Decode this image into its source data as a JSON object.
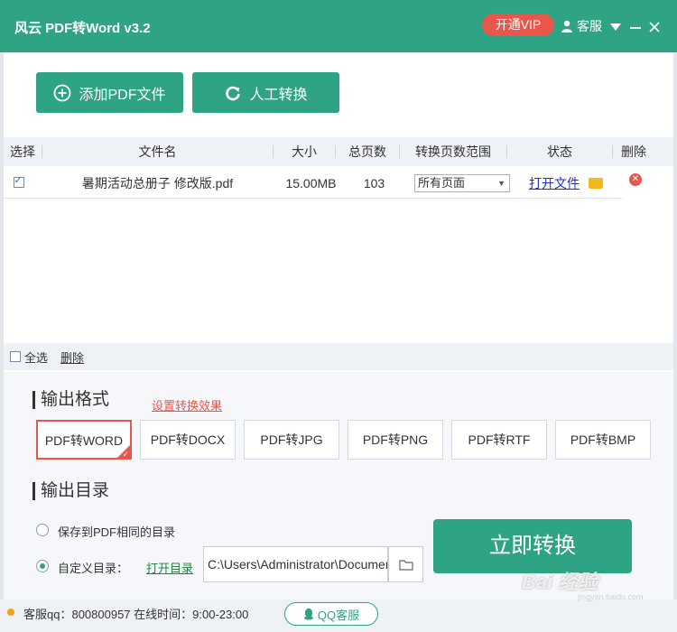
{
  "titlebar": {
    "title": "风云 PDF转Word v3.2",
    "vip_label": "开通VIP",
    "service_label": "客服",
    "menu_icon": "caret-down-icon",
    "minimize_icon": "minimize-icon",
    "close_icon": "close-icon"
  },
  "toolbar": {
    "add_pdf_label": "添加PDF文件",
    "manual_label": "人工转换"
  },
  "table": {
    "headers": [
      "选择",
      "文件名",
      "大小",
      "总页数",
      "转换页数范围",
      "状态",
      "删除"
    ],
    "rows": [
      {
        "checked": true,
        "filename": "暑期活动总册子  修改版.pdf",
        "size": "15.00MB",
        "pages": "103",
        "range": "所有页面",
        "status_link": "打开文件"
      }
    ]
  },
  "bulk": {
    "select_all": "全选",
    "delete": "删除"
  },
  "output_format": {
    "title": "输出格式",
    "settings_link": "设置转换效果",
    "options": [
      "PDF转WORD",
      "PDF转DOCX",
      "PDF转JPG",
      "PDF转PNG",
      "PDF转RTF",
      "PDF转BMP"
    ],
    "selected": "PDF转WORD"
  },
  "output_dir": {
    "title": "输出目录",
    "option_same": "保存到PDF相同的目录",
    "option_custom": "自定义目录：",
    "open_dir_link": "打开目录",
    "path_value": "C:\\Users\\Administrator\\Documents"
  },
  "convert_button": "立即转换",
  "status": {
    "text": "客服qq：800800957 在线时间：9:00-23:00",
    "qq_button": "QQ客服"
  },
  "watermark": {
    "logo": "Bai 经验",
    "url": "jingyan.baidu.com"
  },
  "colors": {
    "brand": "#2fa485",
    "accent": "#e9574c"
  }
}
